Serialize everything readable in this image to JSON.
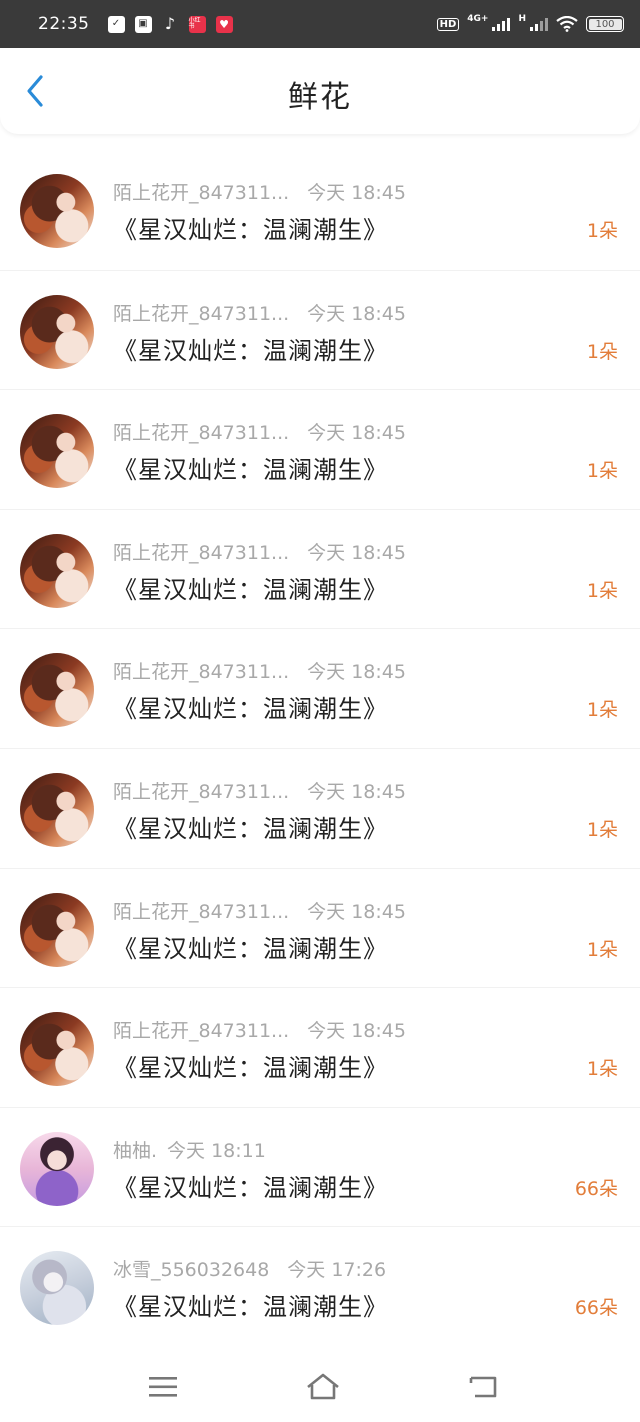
{
  "status_bar": {
    "time": "22:35",
    "battery_level": "100",
    "network": "4G+",
    "network_h": "H",
    "hd": "HD",
    "app_icons": [
      "check-clipboard-icon",
      "gallery-app-icon",
      "tiktok-icon",
      "red-book-app-icon",
      "heart-app-icon"
    ],
    "red_app_text": "小红书"
  },
  "header": {
    "title": "鲜花",
    "back_icon": "chevron-left-icon",
    "accent_color": "#2a8bd8"
  },
  "records": [
    {
      "user": "陌上花开_847311...",
      "time": "今天 18:45",
      "book": "《星汉灿烂：温澜潮生》",
      "count": "1朵",
      "avatar": "girl"
    },
    {
      "user": "陌上花开_847311...",
      "time": "今天 18:45",
      "book": "《星汉灿烂：温澜潮生》",
      "count": "1朵",
      "avatar": "girl"
    },
    {
      "user": "陌上花开_847311...",
      "time": "今天 18:45",
      "book": "《星汉灿烂：温澜潮生》",
      "count": "1朵",
      "avatar": "girl"
    },
    {
      "user": "陌上花开_847311...",
      "time": "今天 18:45",
      "book": "《星汉灿烂：温澜潮生》",
      "count": "1朵",
      "avatar": "girl"
    },
    {
      "user": "陌上花开_847311...",
      "time": "今天 18:45",
      "book": "《星汉灿烂：温澜潮生》",
      "count": "1朵",
      "avatar": "girl"
    },
    {
      "user": "陌上花开_847311...",
      "time": "今天 18:45",
      "book": "《星汉灿烂：温澜潮生》",
      "count": "1朵",
      "avatar": "girl"
    },
    {
      "user": "陌上花开_847311...",
      "time": "今天 18:45",
      "book": "《星汉灿烂：温澜潮生》",
      "count": "1朵",
      "avatar": "girl"
    },
    {
      "user": "陌上花开_847311...",
      "time": "今天 18:45",
      "book": "《星汉灿烂：温澜潮生》",
      "count": "1朵",
      "avatar": "girl"
    },
    {
      "user": "柚柚.",
      "time": "今天 18:11",
      "book": "《星汉灿烂：温澜潮生》",
      "count": "66朵",
      "avatar": "cos"
    },
    {
      "user": "冰雪_556032648",
      "time": "今天 17:26",
      "book": "《星汉灿烂：温澜潮生》",
      "count": "66朵",
      "avatar": "snow"
    }
  ],
  "colors": {
    "count_color": "#e27d3a",
    "meta_color": "#a8a8a8",
    "status_bar_bg": "#3a3a3a"
  },
  "bottom_nav": {
    "icons": [
      "menu-icon",
      "home-icon",
      "back-icon"
    ]
  }
}
